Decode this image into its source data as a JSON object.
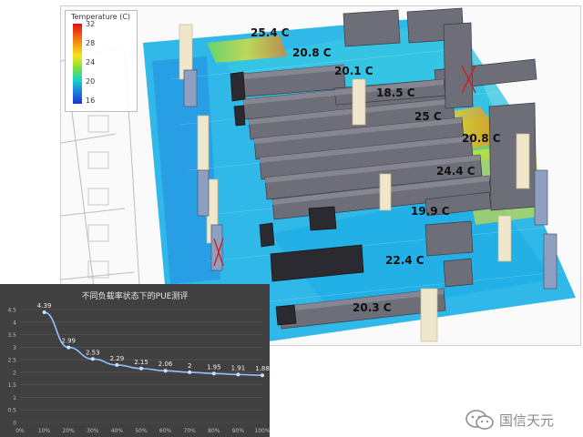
{
  "legend": {
    "title": "Temperature (C)",
    "ticks": [
      "32",
      "28",
      "24",
      "20",
      "16"
    ]
  },
  "temperature_labels": [
    "25.4 C",
    "20.8 C",
    "20.1 C",
    "18.5 C",
    "25 C",
    "20.8 C",
    "24.4 C",
    "19.9 C",
    "22.4 C",
    "20.3 C"
  ],
  "watermark": {
    "text": "国信天元"
  },
  "colors": {
    "chart_bg": "#404040",
    "line": "#8fc1ff",
    "point": "#cfe3ff",
    "grid": "#5a5a5a"
  },
  "chart_data": {
    "type": "line",
    "title": "不同负载率状态下的PUE测评",
    "categories": [
      "0%",
      "10%",
      "20%",
      "30%",
      "40%",
      "50%",
      "60%",
      "70%",
      "80%",
      "90%",
      "100%"
    ],
    "series": [
      {
        "values": [
          null,
          4.39,
          2.99,
          2.53,
          2.29,
          2.15,
          2.06,
          2,
          1.95,
          1.91,
          1.88
        ]
      }
    ],
    "data_labels": [
      "4.39",
      "2.99",
      "2.53",
      "2.29",
      "2.15",
      "2.06",
      "2",
      "1.95",
      "1.91",
      "1.88"
    ],
    "yticks": [
      "0",
      "0.5",
      "1",
      "1.5",
      "2",
      "2.5",
      "3",
      "3.5",
      "4",
      "4.5"
    ],
    "ylim": [
      0,
      4.5
    ],
    "grid": true,
    "xlabel": "",
    "ylabel": ""
  }
}
